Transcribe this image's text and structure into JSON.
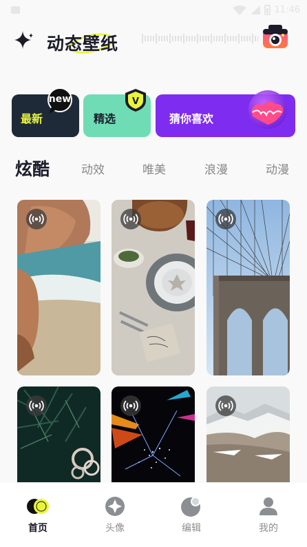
{
  "status_bar": {
    "time": "11:46"
  },
  "header": {
    "title": "动态壁纸"
  },
  "categories": [
    {
      "label": "最新",
      "badge": "new"
    },
    {
      "label": "精选",
      "badge": "V"
    },
    {
      "label": "猜你喜欢"
    }
  ],
  "tabs": [
    {
      "label": "炫酷",
      "active": true
    },
    {
      "label": "动效"
    },
    {
      "label": "唯美"
    },
    {
      "label": "浪漫"
    },
    {
      "label": "动漫"
    }
  ],
  "wallpapers": [
    {
      "subject": "seaside rocks"
    },
    {
      "subject": "dinner table"
    },
    {
      "subject": "suspension bridge"
    },
    {
      "subject": "christmas tree"
    },
    {
      "subject": "light particles"
    },
    {
      "subject": "snowy mountains"
    }
  ],
  "bottom_nav": [
    {
      "label": "首页",
      "icon": "home-icon",
      "active": true
    },
    {
      "label": "头像",
      "icon": "avatar-icon"
    },
    {
      "label": "编辑",
      "icon": "edit-icon"
    },
    {
      "label": "我的",
      "icon": "profile-icon"
    }
  ],
  "colors": {
    "accent_yellow": "#e9f53b",
    "dark_card": "#1f2a38",
    "mint_card": "#6fdcb5",
    "purple_card": "#7e2cf0",
    "background": "#f9f9f9"
  }
}
